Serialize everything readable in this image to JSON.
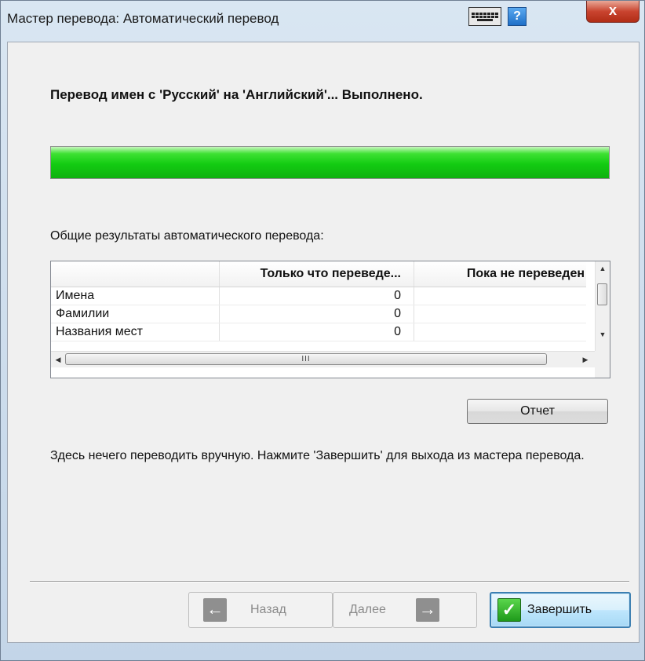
{
  "window": {
    "title": "Мастер перевода: Автоматический перевод",
    "help_label": "?",
    "close_label": "x"
  },
  "main": {
    "heading": "Перевод имен с 'Русский' на 'Английский'... Выполнено.",
    "progress": {
      "percent": 100,
      "color": "#19cc16"
    },
    "results_label": "Общие результаты автоматического перевода:",
    "table": {
      "columns": [
        "",
        "Только что переведе...",
        "Пока не переведен"
      ],
      "rows": [
        {
          "name": "Имена",
          "translated": "0",
          "pending": ""
        },
        {
          "name": "Фамилии",
          "translated": "0",
          "pending": ""
        },
        {
          "name": "Названия мест",
          "translated": "0",
          "pending": ""
        }
      ],
      "hscroll_grip": "III"
    },
    "report_button": "Отчет",
    "info_text": "Здесь нечего переводить вручную. Нажмите 'Завершить' для выхода из мастера перевода."
  },
  "footer": {
    "back_label": "Назад",
    "next_label": "Далее",
    "finish_label": "Завершить",
    "back_icon": "←",
    "next_icon": "→",
    "finish_icon": "✓"
  },
  "colors": {
    "accent": "#3c7fb1",
    "progress_green": "#19cc16",
    "close_red": "#c9442f"
  }
}
